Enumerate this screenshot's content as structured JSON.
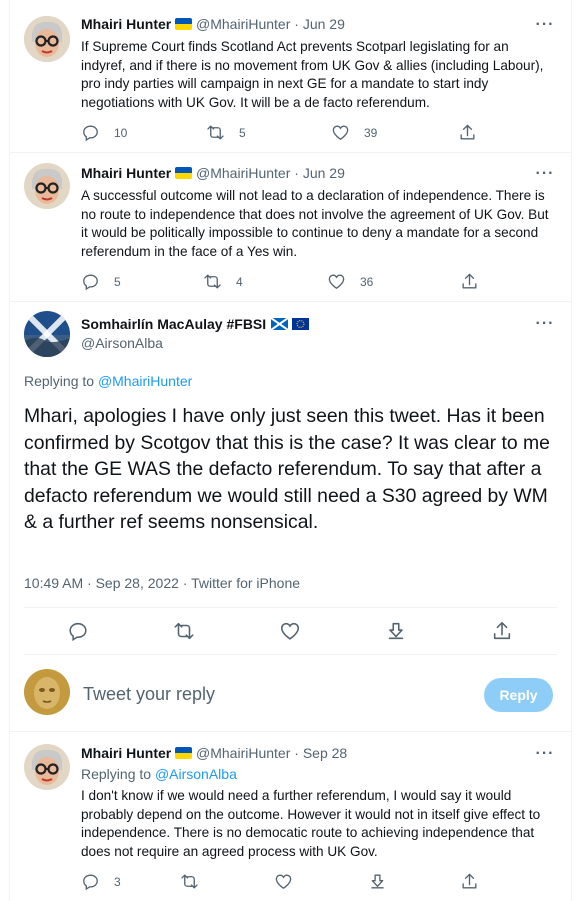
{
  "tweets": [
    {
      "name": "Mhairi Hunter",
      "handle": "@MhairiHunter",
      "sep": "·",
      "date": "Jun 29",
      "text": "If Supreme Court finds Scotland Act prevents Scotparl legislating for an indyref, and if there is no movement from UK Gov & allies (including Labour), pro indy parties will campaign in next GE for a mandate to start indy negotiations with UK Gov. It will be a de facto referendum.",
      "replies": "10",
      "retweets": "5",
      "likes": "39"
    },
    {
      "name": "Mhairi Hunter",
      "handle": "@MhairiHunter",
      "sep": "·",
      "date": "Jun 29",
      "text": "A successful outcome will not lead to a declaration of independence. There is no route to independence that does not involve the agreement of UK Gov. But it would be politically impossible to continue to deny a mandate for a second referendum in the face of a Yes win.",
      "replies": "5",
      "retweets": "4",
      "likes": "36"
    }
  ],
  "main_tweet": {
    "name": "Somhairlín MacAulay #FBSI",
    "handle": "@AirsonAlba",
    "replying_prefix": "Replying to",
    "replying_to": "@MhairiHunter",
    "text": "Mhari, apologies I have only just seen this tweet. Has it been confirmed by Scotgov that this is the case? It was clear to me that the GE WAS the defacto referendum. To say that after a defacto referendum we would still need a S30 agreed by WM & a further ref seems nonsensical.",
    "timestamp": "10:49 AM · Sep 28, 2022 · Twitter for iPhone"
  },
  "composer": {
    "placeholder": "Tweet your reply",
    "button": "Reply"
  },
  "reply": {
    "name": "Mhairi Hunter",
    "handle": "@MhairiHunter",
    "sep": "·",
    "date": "Sep 28",
    "replying_prefix": "Replying to",
    "replying_to": "@AirsonAlba",
    "text": "I don't know if we would need a further referendum, I would say it would probably depend on the outcome. However it would not in itself give effect to independence. There is no democatic route to achieving independence that does not require an agreed process with UK Gov.",
    "replies": "3"
  },
  "colors": {
    "accent": "#1d9bf0",
    "reply_button_disabled": "#8ecdf8",
    "secondary_text": "#536471",
    "divider": "#eff3f4",
    "ua_blue": "#0057b7",
    "ua_yellow": "#ffd700"
  },
  "icons": [
    "more-icon",
    "reply-icon",
    "retweet-icon",
    "like-icon",
    "share-icon",
    "bookmark-icon",
    "ukraine-flag-icon",
    "scotland-flag-icon",
    "eu-flag-icon"
  ]
}
